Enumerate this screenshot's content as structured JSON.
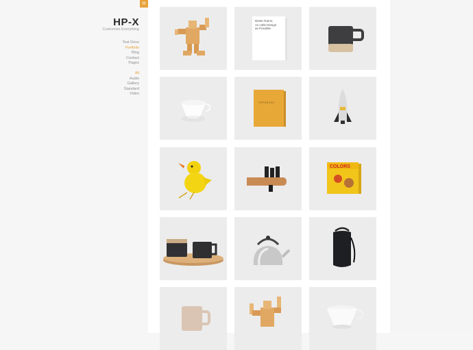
{
  "site": {
    "logo_badge": "H",
    "brand": "HP-X",
    "tagline": "Customize Everything"
  },
  "nav_primary": [
    {
      "label": "Test Drive",
      "active": false
    },
    {
      "label": "Portfolio",
      "active": true
    },
    {
      "label": "Blog",
      "active": false
    },
    {
      "label": "Contact",
      "active": false
    },
    {
      "label": "Pages",
      "active": false
    }
  ],
  "nav_filters": [
    {
      "label": "All",
      "active": true
    },
    {
      "label": "Audio",
      "active": false
    },
    {
      "label": "Gallery",
      "active": false
    },
    {
      "label": "Standard",
      "active": false
    },
    {
      "label": "Video",
      "active": false
    }
  ],
  "portfolio": {
    "tiles": [
      {
        "name": "wooden-robot-figure"
      },
      {
        "name": "book-as-little-design",
        "text": "Dieter Rams:\nAs Little Design\nas Possible"
      },
      {
        "name": "dark-mug"
      },
      {
        "name": "pour-over-dripper"
      },
      {
        "name": "yellow-book",
        "text": "ESPRESSO"
      },
      {
        "name": "rocket-toy"
      },
      {
        "name": "yellow-duck-toy"
      },
      {
        "name": "wood-hook"
      },
      {
        "name": "colors-box",
        "text": "COLORS"
      },
      {
        "name": "mugs-on-tray"
      },
      {
        "name": "kettle"
      },
      {
        "name": "black-backpack"
      },
      {
        "name": "beige-mug"
      },
      {
        "name": "wooden-robot-figure-2"
      },
      {
        "name": "white-dripper"
      }
    ]
  },
  "colors": {
    "accent": "#e8a33a",
    "tile_bg": "#ececec",
    "sidebar_bg": "#f6f6f6"
  }
}
